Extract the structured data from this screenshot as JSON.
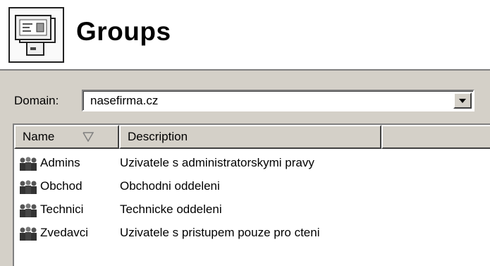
{
  "header": {
    "title": "Groups",
    "icon": "groups-folder-icon"
  },
  "domain": {
    "label": "Domain:",
    "value": "nasefirma.cz"
  },
  "list": {
    "columns": {
      "name": "Name",
      "description": "Description"
    },
    "sort_icon": "sort-descending-icon",
    "rows": [
      {
        "name": "Admins",
        "description": "Uzivatele s administratorskymi pravy"
      },
      {
        "name": "Obchod",
        "description": "Obchodni oddeleni"
      },
      {
        "name": "Technici",
        "description": "Technicke oddeleni"
      },
      {
        "name": "Zvedavci",
        "description": "Uzivatele s pristupem pouze pro cteni"
      }
    ]
  },
  "colors": {
    "panel": "#d4d0c8",
    "window": "#ffffff",
    "text": "#000000"
  }
}
